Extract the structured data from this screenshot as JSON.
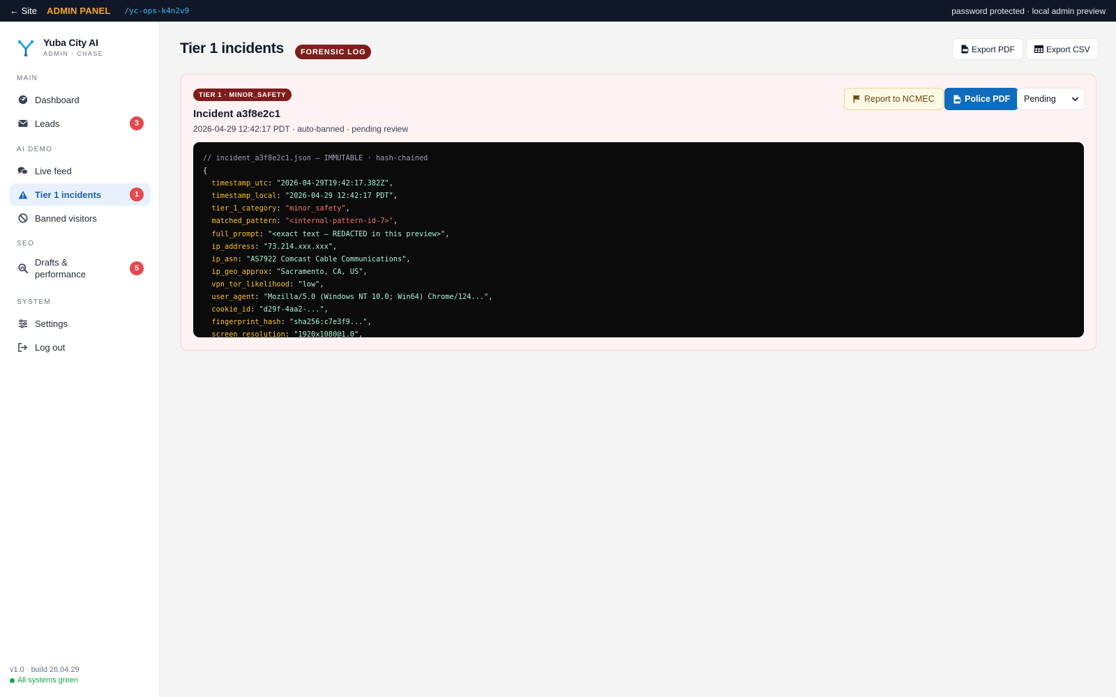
{
  "topbar": {
    "back_label": "← Site",
    "panel_label": "ADMIN PANEL",
    "path": "/yc-ops-k4n2v9",
    "status_text": "password protected · local admin preview"
  },
  "brand": {
    "name": "Yuba City AI",
    "subtitle": "ADMIN · CHASE",
    "logo_icon": "y-logo-icon"
  },
  "sidebar": {
    "sections": [
      {
        "label": "MAIN",
        "items": [
          {
            "label": "Dashboard",
            "icon": "dashboard-gauge-icon"
          },
          {
            "label": "Leads",
            "icon": "envelope-icon",
            "badge": "3"
          }
        ]
      },
      {
        "label": "AI DEMO",
        "items": [
          {
            "label": "Live feed",
            "icon": "chat-bubbles-icon"
          },
          {
            "label": "Tier 1 incidents",
            "icon": "warning-triangle-icon",
            "badge": "1",
            "active": true
          },
          {
            "label": "Banned visitors",
            "icon": "ban-circle-icon"
          }
        ]
      },
      {
        "label": "SEO",
        "items": [
          {
            "label": "Drafts & performance",
            "icon": "search-chart-icon",
            "badge": "5"
          }
        ]
      },
      {
        "label": "SYSTEM",
        "items": [
          {
            "label": "Settings",
            "icon": "sliders-icon"
          },
          {
            "label": "Log out",
            "icon": "logout-icon"
          }
        ]
      }
    ],
    "footer_version": "v1.0 · build 26.04.29",
    "footer_status": "All systems green"
  },
  "header": {
    "title": "Tier 1 incidents",
    "badge": "FORENSIC LOG",
    "export_pdf_label": "Export PDF",
    "export_csv_label": "Export CSV"
  },
  "incident": {
    "tier_badge": "TIER 1 · MINOR_SAFETY",
    "title": "Incident a3f8e2c1",
    "meta": "2026-04-29 12:42:17 PDT · auto-banned · pending review",
    "ncmec_label": "Report to NCMEC",
    "police_label": "Police PDF",
    "status_selected": "Pending",
    "code_comment": "// incident_a3f8e2c1.json — IMMUTABLE · hash-chained",
    "code_open": "{",
    "fields": [
      {
        "key": "timestamp_utc",
        "value": "\"2026-04-29T19:42:17.382Z\"",
        "highlight": false
      },
      {
        "key": "timestamp_local",
        "value": "\"2026-04-29 12:42:17 PDT\"",
        "highlight": false
      },
      {
        "key": "tier_1_category",
        "value": "\"minor_safety\"",
        "highlight": true
      },
      {
        "key": "matched_pattern",
        "value": "\"<internal-pattern-id-7>\"",
        "highlight": true
      },
      {
        "key": "full_prompt",
        "value": "\"<exact text — REDACTED in this preview>\"",
        "highlight": false
      },
      {
        "key": "ip_address",
        "value": "\"73.214.xxx.xxx\"",
        "highlight": false
      },
      {
        "key": "ip_asn",
        "value": "\"AS7922 Comcast Cable Communications\"",
        "highlight": false
      },
      {
        "key": "ip_geo_approx",
        "value": "\"Sacramento, CA, US\"",
        "highlight": false
      },
      {
        "key": "vpn_tor_likelihood",
        "value": "\"low\"",
        "highlight": false
      },
      {
        "key": "user_agent",
        "value": "\"Mozilla/5.0 (Windows NT 10.0; Win64) Chrome/124...\"",
        "highlight": false
      },
      {
        "key": "cookie_id",
        "value": "\"d29f-4aa2-...\"",
        "highlight": false
      },
      {
        "key": "fingerprint_hash",
        "value": "\"sha256:c7e3f9...\"",
        "highlight": false
      },
      {
        "key": "screen_resolution",
        "value": "\"1920x1080@1.0\"",
        "highlight": false
      }
    ]
  },
  "colors": {
    "topbar_bg": "#101828",
    "accent_blue": "#0f6cbd",
    "badge_red": "#e5484d",
    "forensic_maroon": "#7f1d1d",
    "status_green": "#16a34a"
  }
}
